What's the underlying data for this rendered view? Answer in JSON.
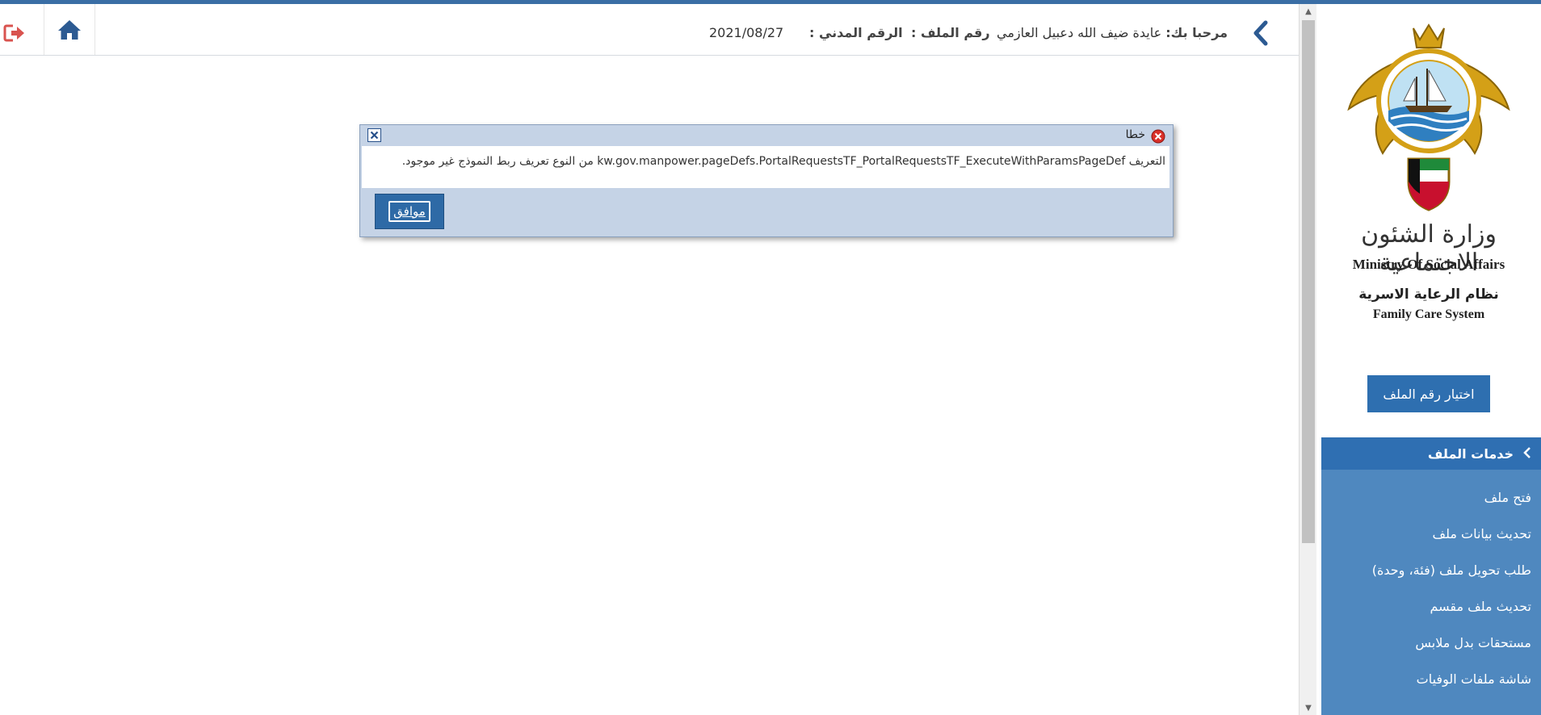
{
  "header": {
    "welcome_label": "مرحبا بك:",
    "user_name": "عايدة ضيف الله دعبيل العازمي",
    "file_number_label": "رقم الملف :",
    "civil_id_label": "الرقم المدني :",
    "date": "2021/08/27",
    "icons": {
      "collapse": "chevron-left-icon",
      "home": "home-icon",
      "logout": "logout-icon"
    }
  },
  "dialog": {
    "title": "خطا",
    "message": "التعريف kw.gov.manpower.pageDefs.PortalRequestsTF_PortalRequestsTF_ExecuteWithParamsPageDef من النوع تعريف ربط النموذج غير موجود.",
    "ok_label": "موافق",
    "icons": {
      "error": "error-icon",
      "close": "close-icon"
    }
  },
  "sidebar": {
    "ministry_ar": "وزارة الشئون الاجتماعية",
    "ministry_en": "Ministry Of Social Affairs",
    "system_ar": "نظام الرعاية الاسرية",
    "system_en": "Family Care System",
    "select_file_button": "اختيار رقم الملف",
    "menu_title": "خدمات الملف",
    "menu_items": [
      "فتح ملف",
      "تحديث بيانات ملف",
      "طلب تحويل ملف (فئة، وحدة)",
      "تحديث ملف مقسم",
      "مستحقات بدل ملابس",
      "شاشة ملفات الوفيات"
    ]
  },
  "colors": {
    "accent": "#2e6fb0",
    "menu_bg": "#4f88bf",
    "menu_header": "#2f6fb2",
    "dialog_bg": "#c5d3e6",
    "logout": "#d9534f"
  }
}
